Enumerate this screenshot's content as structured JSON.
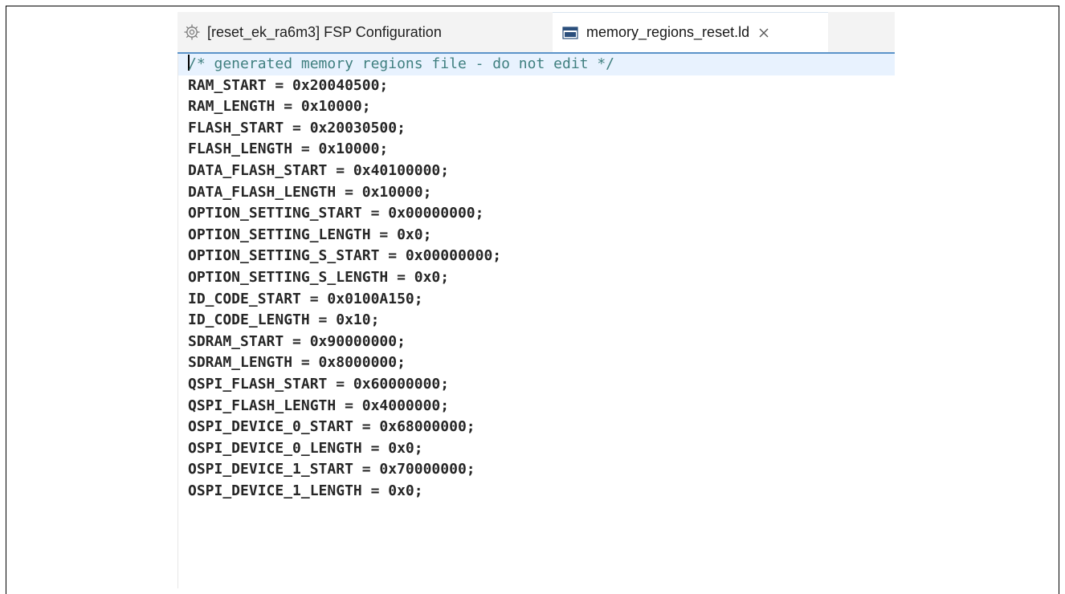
{
  "tabs": {
    "fsp": {
      "label": "[reset_ek_ra6m3] FSP Configuration",
      "icon": "gear-icon"
    },
    "ld": {
      "label": "memory_regions_reset.ld",
      "icon": "document-icon",
      "active": true
    }
  },
  "colors": {
    "tab_underline": "#5b93c9",
    "comment": "#3f7f7f",
    "current_line": "#e8f2fe"
  },
  "editor": {
    "comment": "/* generated memory regions file - do not edit */",
    "lines": [
      "RAM_START = 0x20040500;",
      "RAM_LENGTH = 0x10000;",
      "FLASH_START = 0x20030500;",
      "FLASH_LENGTH = 0x10000;",
      "DATA_FLASH_START = 0x40100000;",
      "DATA_FLASH_LENGTH = 0x10000;",
      "OPTION_SETTING_START = 0x00000000;",
      "OPTION_SETTING_LENGTH = 0x0;",
      "OPTION_SETTING_S_START = 0x00000000;",
      "OPTION_SETTING_S_LENGTH = 0x0;",
      "ID_CODE_START = 0x0100A150;",
      "ID_CODE_LENGTH = 0x10;",
      "SDRAM_START = 0x90000000;",
      "SDRAM_LENGTH = 0x8000000;",
      "QSPI_FLASH_START = 0x60000000;",
      "QSPI_FLASH_LENGTH = 0x4000000;",
      "OSPI_DEVICE_0_START = 0x68000000;",
      "OSPI_DEVICE_0_LENGTH = 0x0;",
      "OSPI_DEVICE_1_START = 0x70000000;",
      "OSPI_DEVICE_1_LENGTH = 0x0;"
    ]
  }
}
